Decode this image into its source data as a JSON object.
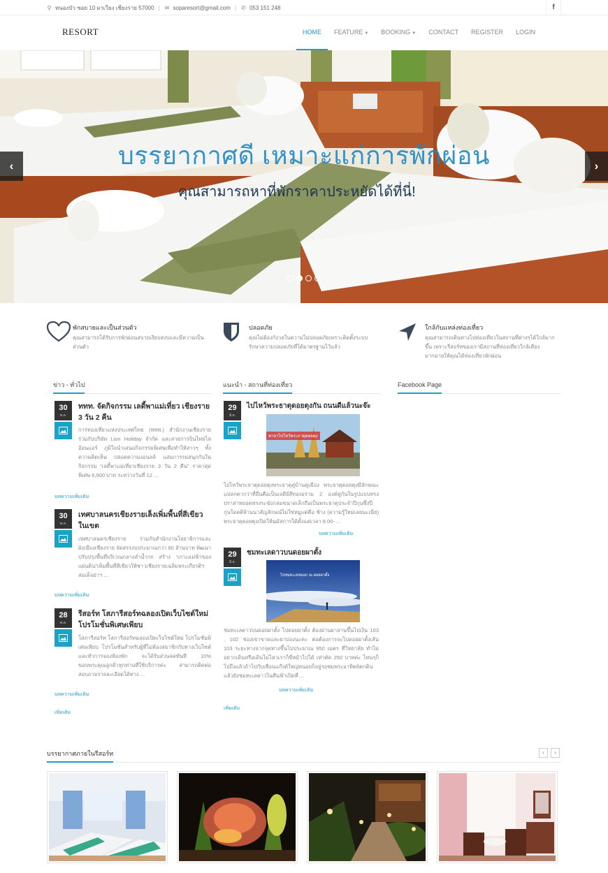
{
  "topbar": {
    "address": "หนองบัว ซอย 10 ผาเวียง เชียงราย 57000",
    "email": "soparesort@gmail.com",
    "phone": "053 151 248",
    "facebook": "f"
  },
  "nav": {
    "logo": "RESORT",
    "items": [
      {
        "label": "HOME",
        "active": true
      },
      {
        "label": "FEATURE",
        "dropdown": true
      },
      {
        "label": "BOOKING",
        "dropdown": true
      },
      {
        "label": "CONTACT"
      },
      {
        "label": "REGISTER"
      },
      {
        "label": "LOGIN"
      }
    ]
  },
  "hero": {
    "title": "บรรยากาศดี เหมาะแก่การพักผ่อน",
    "subtitle": "คุณสามารถหาที่พักราคาประหยัดได้ที่นี่!",
    "prev": "‹",
    "next": "›",
    "slides": 4,
    "active_slide": 2
  },
  "features": [
    {
      "icon": "heart-icon",
      "title": "พักสบายและเป็นส่วนตัว",
      "text": "คุณสามารถได้รับการพักผ่อนสบายเงียบสงบและมีความเป็นส่วนตัว"
    },
    {
      "icon": "shield-icon",
      "title": "ปลอดภัย",
      "text": "คุณไม่ต้องกังวลในความไม่ปลอดภัยเพราะติดตั้งระบบรักษาความปลอดภัยที่ได้มาตรฐานไว้แล้ว"
    },
    {
      "icon": "location-arrow-icon",
      "title": "ใกล้กับแหล่งท่องเที่ยว",
      "text": "คุณสามารถเดินทางไปท่องเที่ยวในสถานที่ต่างๆได้ใกล้มากขึ้น เพราะรีสอร์ทของเรามีสถานที่ท่องเที่ยวใกล้เคียงมากมายให้คุณได้ท่องเที่ยวพักผ่อน"
    }
  ],
  "news": {
    "heading": "ข่าว - ทั่วไป",
    "posts": [
      {
        "day": "30",
        "month": "พ.ค.",
        "title": "ททท. จัดกิจกรรม เลดี้พาแม่เที่ยว เชียงราย 3 วัน 2 คืน",
        "body": "การท่องเที่ยวแห่งประเทศไทย (ททท.) สำนักงานเชียงราย ร่วมกับบริษัท Lion Holiday จำกัด และสายการบินไทยไลอ้อนแอร์ ภูมิใจนำเสนอกิจกรรมพิเศษเพื่อทำให้สาวๆ ทั้งความคิดเห็น ปลอดความงอนลล์ แสมการรมสนุกกันในกิจกรรม “เลดี้พาแม่เที่ยวเชียงราย 3 วัน 2 คืน” ราคาสุดพิเศษ 6,900 บาท ระหว่างวันที่ 12 ...",
        "more": "บทความเพิ่มเติม"
      },
      {
        "day": "30",
        "month": "พ.ค.",
        "title": "เทศบาลนครเชียงรายเล็งเพิ่มพื้นที่สีเขียวในเขต",
        "body": "เทศบาลนครเชียงราย ร่วมกับสำนักงานโยธาธิการและผังเมืองเชียงราย จัดสรรงบประมาณกว่า 80 ล้านบาท พัฒนาปรับปรุงพื้นที่บริเวณกลางลำน้ำกก สร้าง “เกาะแม่ฟ้าของแผ่นดิน”เพิ่มพื้นที่สีเขียวให้ชาวเชียงรายเฉลิมพระเกียรติฯ สมเด็จย่าฯ ...",
        "more": "บทความเพิ่มเติม"
      },
      {
        "day": "28",
        "month": "พ.ค.",
        "title": "รีสอร์ท โสภารีสอร์ทฉลองเปิดเว็บไซต์ใหม่ โปรโมชั่นพิเศษเพียบ",
        "body": "โสภารีสอร์ท โสภารีสอร์ทฉลองเปิดเว็บไซต์ใหม่ โปรโมชั่นพิเศษเพียบ โปรโมชั่นสำหรับผู้ที่ไม่ต้องสมาชิกกับทางเว็บไซต์และทำการจองห้องพัก จะได้รับส่วนลดทันที 10% ขอบพระคุณลูกค้าทุกท่านที่ใช้บริการค่ะ สามารถติดต่อสอบถามรายละเอียดได้ทาง ...",
        "more": "บทความเพิ่มเติม"
      }
    ],
    "all": "เพิ่มเติม"
  },
  "places": {
    "heading": "แนะนำ - สถานที่ท่องเที่ยว",
    "posts": [
      {
        "day": "29",
        "month": "มิ.ย.",
        "title": "ไปไหว้พระธาตุดอยตุงกัน ถนนดีแล้วนะจ๊ะ",
        "image_caption": "พาลาไปไหว้พระธาตุดอยตุง",
        "body": "ไปไหว้พระธาตุดอยตุงพระธาตุคู่บ้านคู่เมือง พระธาตุดอยตุงมีลักษณะแปลกตากว่าที่อื่นคือเป็นเจดีย์สีทองอร่าม 2 องค์คู่กันในรูปแบบทรงปราสาทยอดทรงระฆังกลมขนาดเล็กถือเป็นพระธาตุประจำปีกุนซึ่งปีกุนใดคติล้านนาสัญลักษณ์ไม่ใช่หมูแต่คือ ช้าง (ความรู้ใหม่เลยนะเนี่ย) พระธาตุดอยตุงเปิดให้นมัสการได้ตั้งแต่เวลา 8.00- ...",
        "more": "บทความเพิ่มเติม"
      },
      {
        "day": "29",
        "month": "มิ.ย.",
        "title": "ชมทะเลดาวบนดอยผาตั้ง",
        "image_caption": "ไปชมทะเลหมอก ณ ดอยผาตั้ง",
        "body": "ชมทะเลดาวบนดอยผาตั้ง ไปดอยผาตั้ง ต้องผ่านผาลานขึ้นไปเงิน 103 , 102 ช่องเขาขาดและผาบ่องนะคะ ต่อต้องการจะไปดอยผาตั้งเส้น 103 ระยะทางจากจุดทางขึ้นไปประมาณ 950 เมตร ที่วิทยาลัย ทำไม่อยากเดินหรือเดินไม่ไหวเราก็ขี่หม้าไปได้ เท่าตัด 250 บาทค่ะ ไหนๆก็ไปถึงแล้วถ้าไปกับเพื่อนแก๊งค์ใหญ่หน่อยก็อยู่รอชมพระอาทิตย์ตกดิน แล้วยังชมทะเลดาวในคืนฟ้าเปิดที่ ...",
        "more": "บทความเพิ่มเติม"
      }
    ],
    "all": "เพิ่มเติม"
  },
  "facebook": {
    "heading": "Facebook Page"
  },
  "gallery": {
    "heading": "บรรยากาศภายในรีสอร์ท",
    "prev": "‹",
    "next": "›",
    "images": [
      "room-twin-beds",
      "night-lights-garden",
      "garden-pathway-evening",
      "room-sitting-area"
    ]
  }
}
